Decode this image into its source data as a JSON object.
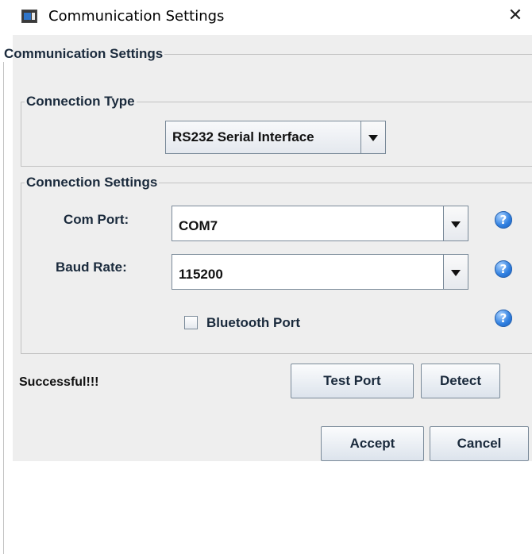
{
  "window": {
    "title": "Communication Settings",
    "close_glyph": "✕",
    "icon": "java-window-icon"
  },
  "outer_group": {
    "legend": "Communication Settings"
  },
  "connection_type": {
    "legend": "Connection Type",
    "selected": "RS232 Serial Interface"
  },
  "connection_settings": {
    "legend": "Connection Settings",
    "com_port_label": "Com Port:",
    "com_port_value": "COM7",
    "baud_rate_label": "Baud Rate:",
    "baud_rate_value": "115200",
    "bluetooth_label": "Bluetooth Port",
    "bluetooth_checked": false,
    "help_glyph": "?"
  },
  "status_text": "Successful!!!",
  "buttons": {
    "test_port": "Test Port",
    "detect": "Detect",
    "accept": "Accept",
    "cancel": "Cancel"
  },
  "colors": {
    "label_text": "#1a2a3c",
    "help_icon": "#2f7fe0",
    "panel_bg": "#eeeeee"
  }
}
